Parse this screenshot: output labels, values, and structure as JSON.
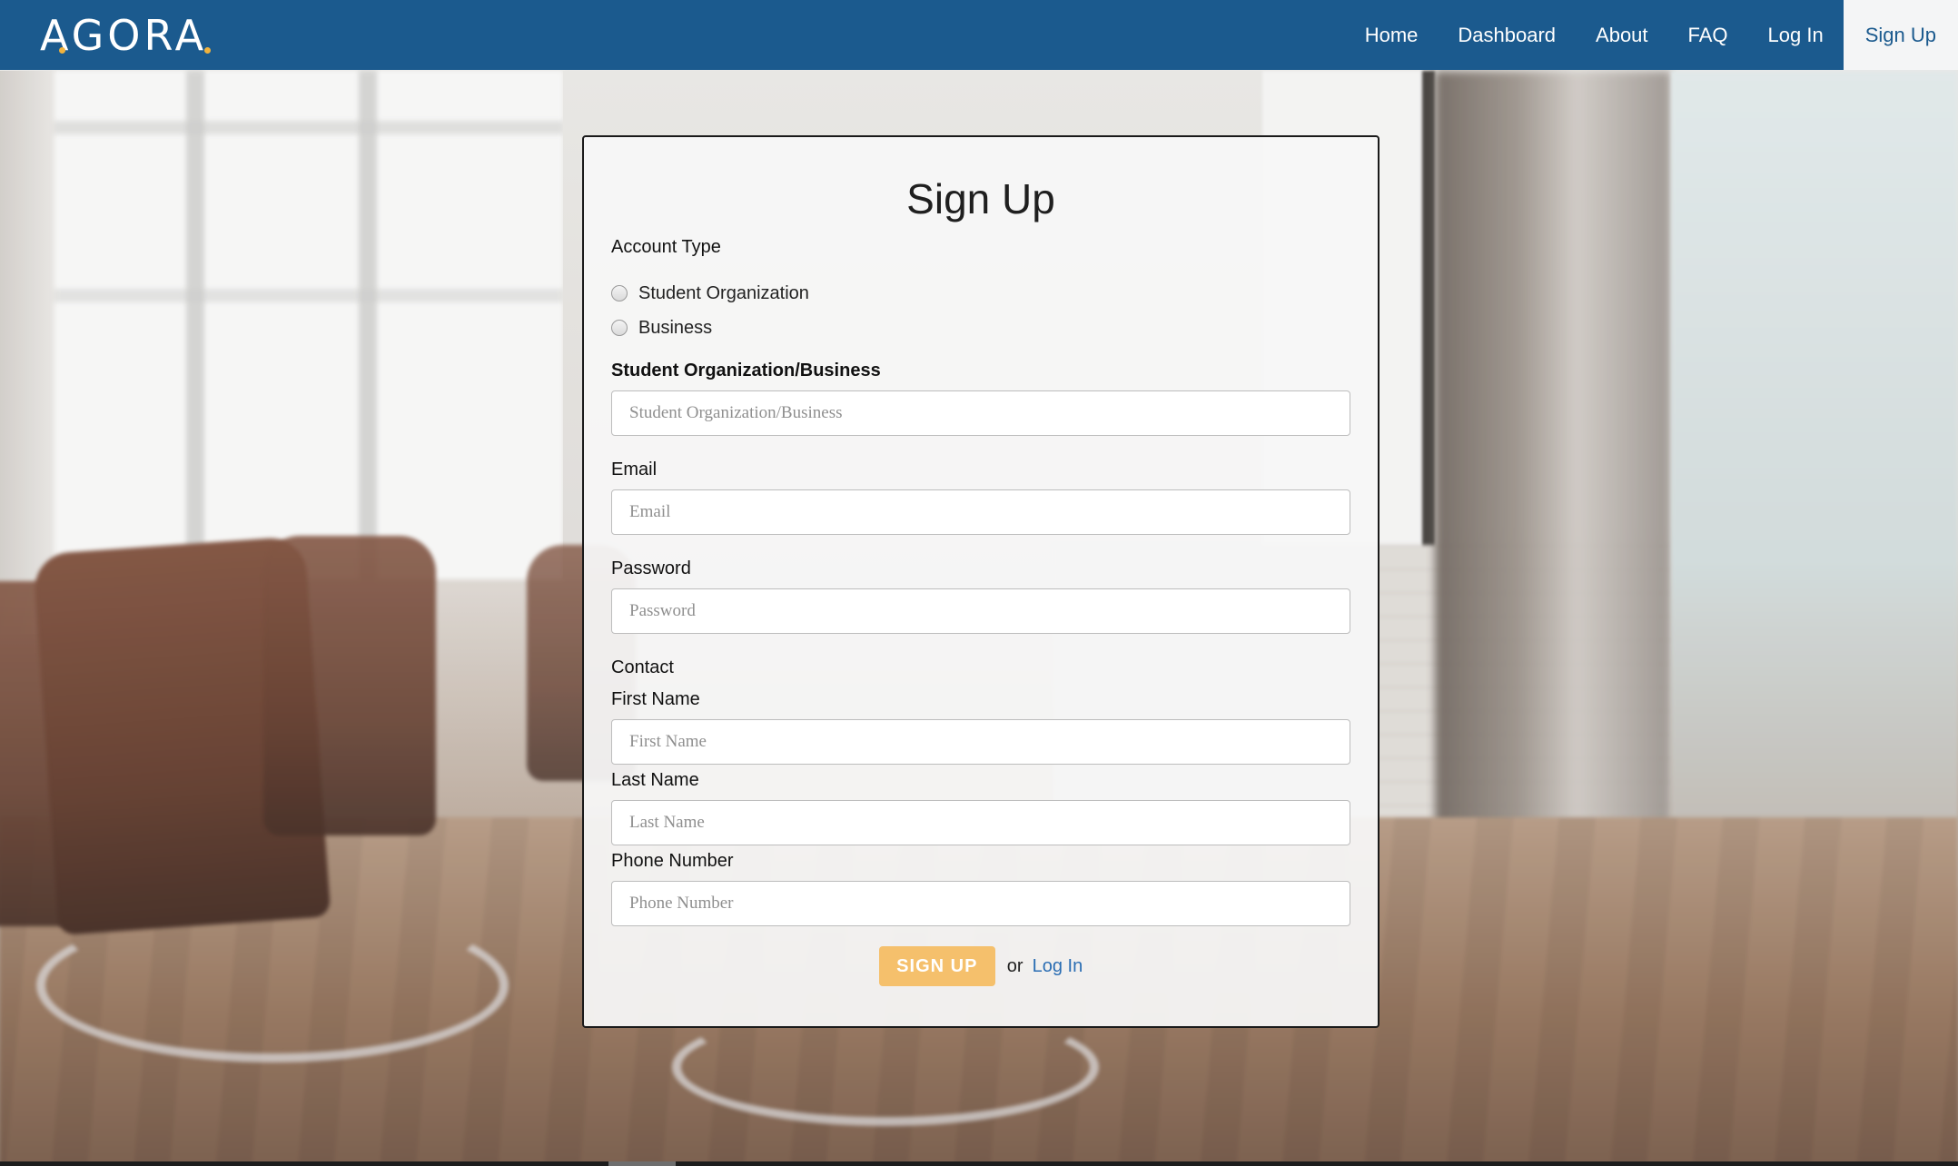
{
  "brand": {
    "name": "AGORA",
    "accent_color": "#f0b23d"
  },
  "navbar": {
    "background": "#1b5a8e",
    "links": [
      {
        "label": "Home"
      },
      {
        "label": "Dashboard"
      },
      {
        "label": "About"
      },
      {
        "label": "FAQ"
      },
      {
        "label": "Log In"
      },
      {
        "label": "Sign Up",
        "active": true
      }
    ]
  },
  "form": {
    "title": "Sign Up",
    "account_type": {
      "label": "Account Type",
      "options": [
        {
          "label": "Student Organization",
          "selected": false
        },
        {
          "label": "Business",
          "selected": false
        }
      ]
    },
    "organization": {
      "label": "Student Organization/Business",
      "placeholder": "Student Organization/Business",
      "value": ""
    },
    "email": {
      "label": "Email",
      "placeholder": "Email",
      "value": ""
    },
    "password": {
      "label": "Password",
      "placeholder": "Password",
      "value": ""
    },
    "contact": {
      "label": "Contact",
      "first_name": {
        "label": "First Name",
        "placeholder": "First Name",
        "value": ""
      },
      "last_name": {
        "label": "Last Name",
        "placeholder": "Last Name",
        "value": ""
      },
      "phone": {
        "label": "Phone Number",
        "placeholder": "Phone Number",
        "value": ""
      }
    },
    "submit_label": "SIGN UP",
    "submit_color": "#f5c06c",
    "or_text": "or",
    "login_link": "Log In",
    "link_color": "#2a6db3"
  }
}
